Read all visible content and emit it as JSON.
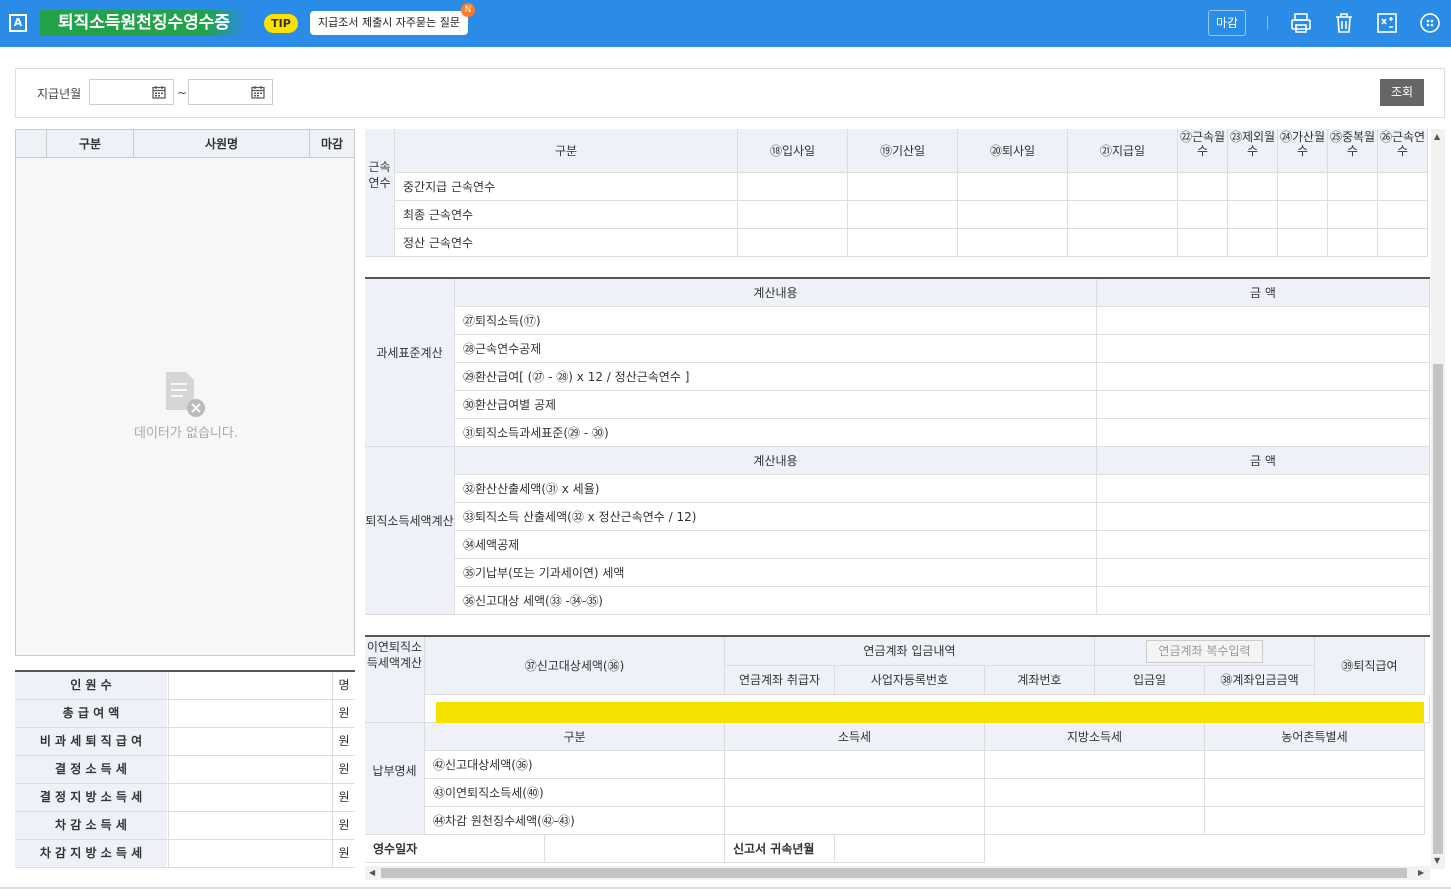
{
  "header": {
    "logo": "A",
    "title": "퇴직소득원천징수영수증",
    "tip": "TIP",
    "faq": "지급조서 제출시 자주묻는 질문",
    "new_badge": "N",
    "close_btn": "마감",
    "icons": [
      "printer-icon",
      "trash-icon",
      "excel-icon",
      "more-icon"
    ]
  },
  "search": {
    "label": "지급년월",
    "from": "",
    "to": "",
    "sep": "~",
    "query_btn": "조회"
  },
  "employee_list": {
    "cols": [
      "구분",
      "사원명",
      "마감"
    ],
    "empty": "데이터가 없습니다."
  },
  "stats": [
    {
      "k": "인 원 수",
      "u": "명"
    },
    {
      "k": "총 급 여 액",
      "u": "원"
    },
    {
      "k": "비 과 세 퇴 직 급 여",
      "u": "원"
    },
    {
      "k": "결 정 소 득 세",
      "u": "원"
    },
    {
      "k": "결 정 지 방 소 득 세",
      "u": "원"
    },
    {
      "k": "차 감 소 득 세",
      "u": "원"
    },
    {
      "k": "차 감 지 방 소 득 세",
      "u": "원"
    }
  ],
  "tenure": {
    "side": "근속연수",
    "gubun": "구분",
    "cols": [
      "⑱입사일",
      "⑲기산일",
      "⑳퇴사일",
      "㉑지급일"
    ],
    "cols2": [
      "㉒근속월수",
      "㉓제외월수",
      "㉔가산월수",
      "㉕중복월수",
      "㉖근속연수"
    ],
    "rows": [
      "중간지급 근속연수",
      "최종 근속연수",
      "정산 근속연수"
    ]
  },
  "tax_base": {
    "side": "과세표준계산",
    "h1": "계산내용",
    "h2": "금 액",
    "rows": [
      "㉗퇴직소득(⑰)",
      "㉘근속연수공제",
      "㉙환산급여[ (㉗ - ㉘) x 12 / 정산근속연수 ]",
      "㉚환산급여별 공제",
      "㉛퇴직소득과세표준(㉙ - ㉚)"
    ]
  },
  "tax_calc": {
    "side": "퇴직소득세액계산",
    "h1": "계산내용",
    "h2": "금 액",
    "rows": [
      "㉜환산산출세액(㉛ x 세율)",
      "㉝퇴직소득 산출세액(㉜ x 정산근속연수 / 12)",
      "㉞세액공제",
      "㉟기납부(또는 기과세이연) 세액",
      "㊱신고대상 세액(㉝ -㉞-㉟)"
    ]
  },
  "deferred": {
    "side": "이연퇴직소득세액계산",
    "c37": "㊲신고대상세액(㊱)",
    "dep": "연금계좌 입금내역",
    "multi_btn": "연금계좌 복수입력",
    "c39": "㊴퇴직급여",
    "subs": [
      "연금계좌 취급자",
      "사업자등록번호",
      "계좌번호",
      "입금일",
      "㊳계좌입금금액"
    ]
  },
  "payment": {
    "side": "납부명세",
    "gubun": "구분",
    "cols": [
      "소득세",
      "지방소득세",
      "농어촌특별세"
    ],
    "rows": [
      "㊷신고대상세액(㊱)",
      "㊸이연퇴직소득세(㊵)",
      "㊹차감 원천징수세액(㊷-㊸)"
    ]
  },
  "footer": {
    "receipt": "영수일자",
    "belong": "신고서 귀속년월"
  },
  "colors": {
    "header": "#2b8ce8",
    "title_bg": "#22a34a",
    "tip": "#ffe000",
    "highlight": "#f5e100"
  }
}
